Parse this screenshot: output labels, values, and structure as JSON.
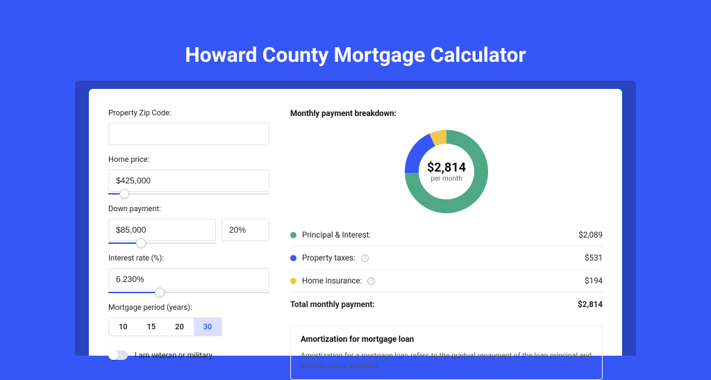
{
  "title": "Howard County Mortgage Calculator",
  "form": {
    "zip_label": "Property Zip Code:",
    "zip_value": "",
    "home_price_label": "Home price:",
    "home_price_value": "$425,000",
    "down_payment_label": "Down payment:",
    "down_payment_value": "$85,000",
    "down_payment_pct": "20%",
    "interest_label": "Interest rate (%):",
    "interest_value": "6.230%",
    "period_label": "Mortgage period (years):",
    "periods": [
      "10",
      "15",
      "20",
      "30"
    ],
    "period_selected": "30",
    "veteran_label": "I am veteran or military"
  },
  "breakdown": {
    "heading": "Monthly payment breakdown:",
    "center_value": "$2,814",
    "center_sub": "per month",
    "items": [
      {
        "label": "Principal & Interest:",
        "value": "$2,089",
        "color": "#4fa987",
        "info": false
      },
      {
        "label": "Property taxes:",
        "value": "$531",
        "color": "#3656f5",
        "info": true
      },
      {
        "label": "Home insurance:",
        "value": "$194",
        "color": "#f3c64d",
        "info": true
      }
    ],
    "total_label": "Total monthly payment:",
    "total_value": "$2,814"
  },
  "amort": {
    "heading": "Amortization for mortgage loan",
    "text": "Amortization for a mortgage loan refers to the gradual repayment of the loan principal and interest over a specified"
  },
  "chart_data": {
    "type": "pie",
    "title": "Monthly payment breakdown",
    "series": [
      {
        "name": "Principal & Interest",
        "value": 2089,
        "color": "#4fa987"
      },
      {
        "name": "Property taxes",
        "value": 531,
        "color": "#3656f5"
      },
      {
        "name": "Home insurance",
        "value": 194,
        "color": "#f3c64d"
      }
    ],
    "total": 2814,
    "center_label": "$2,814 per month"
  }
}
